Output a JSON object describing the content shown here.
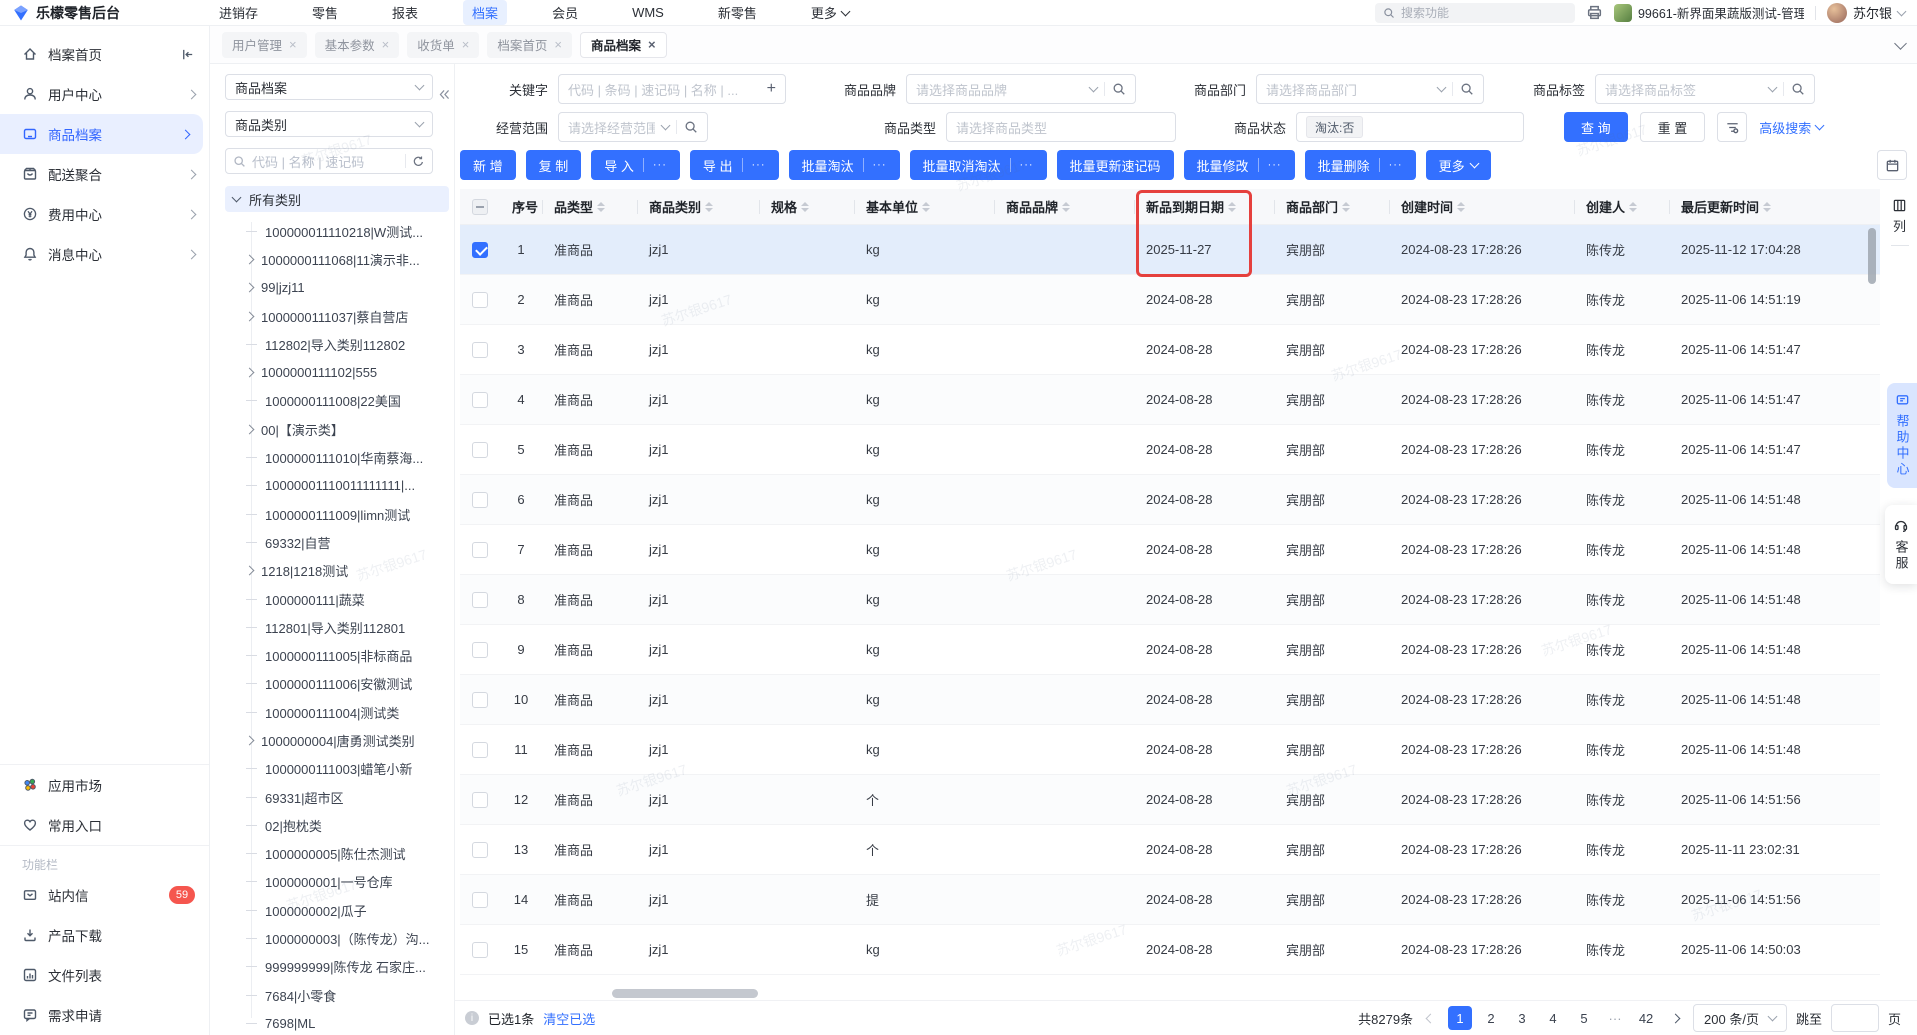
{
  "topnav": {
    "logo": "乐檬零售后台",
    "menu": [
      "进销存",
      "零售",
      "报表",
      "档案",
      "会员",
      "WMS",
      "新零售",
      "更多"
    ],
    "active_index": 3,
    "search_placeholder": "搜索功能",
    "tenant": "99661-新界面果蔬版测试-管理...",
    "user": "苏尔银"
  },
  "tabs": [
    {
      "label": "用户管理",
      "active": false
    },
    {
      "label": "基本参数",
      "active": false
    },
    {
      "label": "收货单",
      "active": false
    },
    {
      "label": "档案首页",
      "active": false
    },
    {
      "label": "商品档案",
      "active": true
    }
  ],
  "sidebar": {
    "items": [
      {
        "label": "档案首页"
      },
      {
        "label": "用户中心"
      },
      {
        "label": "商品档案"
      },
      {
        "label": "配送聚合"
      },
      {
        "label": "费用中心"
      },
      {
        "label": "消息中心"
      }
    ],
    "secondary": [
      {
        "label": "应用市场"
      },
      {
        "label": "常用入口"
      }
    ],
    "section_label": "功能栏",
    "tools": [
      {
        "label": "站内信",
        "badge": "59"
      },
      {
        "label": "产品下载"
      },
      {
        "label": "文件列表"
      },
      {
        "label": "需求申请"
      }
    ]
  },
  "tree": {
    "archive_select": "商品档案",
    "category_select": "商品类别",
    "search_placeholder": "代码 | 名称 | 速记码",
    "root": "所有类别",
    "items": [
      {
        "text": "100000011110218|W测试...",
        "expand": false
      },
      {
        "text": "1000000111068|11演示非...",
        "expand": true
      },
      {
        "text": "99|jzj11",
        "expand": true
      },
      {
        "text": "1000000111037|蔡自营店",
        "expand": true
      },
      {
        "text": "112802|导入类别112802",
        "expand": false
      },
      {
        "text": "1000000111102|555",
        "expand": true
      },
      {
        "text": "1000000111008|22美国",
        "expand": false
      },
      {
        "text": "00|【演示类】",
        "expand": true
      },
      {
        "text": "1000000111010|华南蔡海...",
        "expand": false
      },
      {
        "text": "10000001110011111111|...",
        "expand": false
      },
      {
        "text": "1000000111009|limn测试",
        "expand": false
      },
      {
        "text": "69332|自营",
        "expand": false
      },
      {
        "text": "1218|1218测试",
        "expand": true
      },
      {
        "text": "1000000111|蔬菜",
        "expand": false
      },
      {
        "text": "112801|导入类别112801",
        "expand": false
      },
      {
        "text": "1000000111005|非标商品",
        "expand": false
      },
      {
        "text": "1000000111006|安徽测试",
        "expand": false
      },
      {
        "text": "1000000111004|测试类",
        "expand": false
      },
      {
        "text": "1000000004|唐勇测试类别",
        "expand": true
      },
      {
        "text": "1000000111003|蜡笔小新",
        "expand": false
      },
      {
        "text": "69331|超市区",
        "expand": false
      },
      {
        "text": "02|抱枕类",
        "expand": false
      },
      {
        "text": "1000000005|陈仕杰测试",
        "expand": false
      },
      {
        "text": "1000000001|一号仓库",
        "expand": false
      },
      {
        "text": "1000000002|瓜子",
        "expand": false
      },
      {
        "text": "1000000003|（陈传龙）沟...",
        "expand": false
      },
      {
        "text": "999999999|陈传龙 石家庄...",
        "expand": false
      },
      {
        "text": "7684|小零食",
        "expand": false
      },
      {
        "text": "7698|ML",
        "expand": false
      }
    ]
  },
  "filters": {
    "keyword_label": "关键字",
    "keyword_placeholder": "代码 | 条码 | 速记码 | 名称 | ...",
    "brand_label": "商品品牌",
    "brand_placeholder": "请选择商品品牌",
    "dept_label": "商品部门",
    "dept_placeholder": "请选择商品部门",
    "tag_label": "商品标签",
    "tag_placeholder": "请选择商品标签",
    "scope_label": "经营范围",
    "scope_placeholder": "请选择经营范围",
    "type_label": "商品类型",
    "type_placeholder": "请选择商品类型",
    "status_label": "商品状态",
    "status_tag": "淘汰:否",
    "query_btn": "查 询",
    "reset_btn": "重 置",
    "advanced_link": "高级搜索"
  },
  "toolbar": {
    "buttons": [
      {
        "label": "新 增",
        "more": false
      },
      {
        "label": "复 制",
        "more": false
      },
      {
        "label": "导 入",
        "more": true
      },
      {
        "label": "导 出",
        "more": true
      },
      {
        "label": "批量淘汰",
        "more": true
      },
      {
        "label": "批量取消淘汰",
        "more": true
      },
      {
        "label": "批量更新速记码",
        "more": false
      },
      {
        "label": "批量修改",
        "more": true
      },
      {
        "label": "批量删除",
        "more": true
      },
      {
        "label": "更多",
        "more": false,
        "dropdown": true
      }
    ]
  },
  "table": {
    "headers": [
      {
        "label": "序号",
        "sortable": false
      },
      {
        "label": "品类型",
        "sortable": true
      },
      {
        "label": "商品类别",
        "sortable": true
      },
      {
        "label": "规格",
        "sortable": true
      },
      {
        "label": "基本单位",
        "sortable": true
      },
      {
        "label": "商品品牌",
        "sortable": true
      },
      {
        "label": "新品到期日期",
        "sortable": true,
        "annotated": true
      },
      {
        "label": "商品部门",
        "sortable": true
      },
      {
        "label": "创建时间",
        "sortable": true
      },
      {
        "label": "创建人",
        "sortable": true
      },
      {
        "label": "最后更新时间",
        "sortable": true
      }
    ],
    "rows": [
      {
        "seq": "1",
        "type": "准商品",
        "category": "jzj1",
        "spec": "",
        "unit": "kg",
        "brand": "",
        "new_date": "2025-11-27",
        "dept": "宾朋部",
        "created": "2024-08-23 17:28:26",
        "creator": "陈传龙",
        "updated": "2025-11-12 17:04:28",
        "selected": true
      },
      {
        "seq": "2",
        "type": "准商品",
        "category": "jzj1",
        "spec": "",
        "unit": "kg",
        "brand": "",
        "new_date": "2024-08-28",
        "dept": "宾朋部",
        "created": "2024-08-23 17:28:26",
        "creator": "陈传龙",
        "updated": "2025-11-06 14:51:19",
        "selected": false
      },
      {
        "seq": "3",
        "type": "准商品",
        "category": "jzj1",
        "spec": "",
        "unit": "kg",
        "brand": "",
        "new_date": "2024-08-28",
        "dept": "宾朋部",
        "created": "2024-08-23 17:28:26",
        "creator": "陈传龙",
        "updated": "2025-11-06 14:51:47",
        "selected": false
      },
      {
        "seq": "4",
        "type": "准商品",
        "category": "jzj1",
        "spec": "",
        "unit": "kg",
        "brand": "",
        "new_date": "2024-08-28",
        "dept": "宾朋部",
        "created": "2024-08-23 17:28:26",
        "creator": "陈传龙",
        "updated": "2025-11-06 14:51:47",
        "selected": false
      },
      {
        "seq": "5",
        "type": "准商品",
        "category": "jzj1",
        "spec": "",
        "unit": "kg",
        "brand": "",
        "new_date": "2024-08-28",
        "dept": "宾朋部",
        "created": "2024-08-23 17:28:26",
        "creator": "陈传龙",
        "updated": "2025-11-06 14:51:47",
        "selected": false
      },
      {
        "seq": "6",
        "type": "准商品",
        "category": "jzj1",
        "spec": "",
        "unit": "kg",
        "brand": "",
        "new_date": "2024-08-28",
        "dept": "宾朋部",
        "created": "2024-08-23 17:28:26",
        "creator": "陈传龙",
        "updated": "2025-11-06 14:51:48",
        "selected": false
      },
      {
        "seq": "7",
        "type": "准商品",
        "category": "jzj1",
        "spec": "",
        "unit": "kg",
        "brand": "",
        "new_date": "2024-08-28",
        "dept": "宾朋部",
        "created": "2024-08-23 17:28:26",
        "creator": "陈传龙",
        "updated": "2025-11-06 14:51:48",
        "selected": false
      },
      {
        "seq": "8",
        "type": "准商品",
        "category": "jzj1",
        "spec": "",
        "unit": "kg",
        "brand": "",
        "new_date": "2024-08-28",
        "dept": "宾朋部",
        "created": "2024-08-23 17:28:26",
        "creator": "陈传龙",
        "updated": "2025-11-06 14:51:48",
        "selected": false
      },
      {
        "seq": "9",
        "type": "准商品",
        "category": "jzj1",
        "spec": "",
        "unit": "kg",
        "brand": "",
        "new_date": "2024-08-28",
        "dept": "宾朋部",
        "created": "2024-08-23 17:28:26",
        "creator": "陈传龙",
        "updated": "2025-11-06 14:51:48",
        "selected": false
      },
      {
        "seq": "10",
        "type": "准商品",
        "category": "jzj1",
        "spec": "",
        "unit": "kg",
        "brand": "",
        "new_date": "2024-08-28",
        "dept": "宾朋部",
        "created": "2024-08-23 17:28:26",
        "creator": "陈传龙",
        "updated": "2025-11-06 14:51:48",
        "selected": false
      },
      {
        "seq": "11",
        "type": "准商品",
        "category": "jzj1",
        "spec": "",
        "unit": "kg",
        "brand": "",
        "new_date": "2024-08-28",
        "dept": "宾朋部",
        "created": "2024-08-23 17:28:26",
        "creator": "陈传龙",
        "updated": "2025-11-06 14:51:48",
        "selected": false
      },
      {
        "seq": "12",
        "type": "准商品",
        "category": "jzj1",
        "spec": "",
        "unit": "个",
        "brand": "",
        "new_date": "2024-08-28",
        "dept": "宾朋部",
        "created": "2024-08-23 17:28:26",
        "creator": "陈传龙",
        "updated": "2025-11-06 14:51:56",
        "selected": false
      },
      {
        "seq": "13",
        "type": "准商品",
        "category": "jzj1",
        "spec": "",
        "unit": "个",
        "brand": "",
        "new_date": "2024-08-28",
        "dept": "宾朋部",
        "created": "2024-08-23 17:28:26",
        "creator": "陈传龙",
        "updated": "2025-11-11 23:02:31",
        "selected": false
      },
      {
        "seq": "14",
        "type": "准商品",
        "category": "jzj1",
        "spec": "",
        "unit": "提",
        "brand": "",
        "new_date": "2024-08-28",
        "dept": "宾朋部",
        "created": "2024-08-23 17:28:26",
        "creator": "陈传龙",
        "updated": "2025-11-06 14:51:56",
        "selected": false
      },
      {
        "seq": "15",
        "type": "准商品",
        "category": "jzj1",
        "spec": "",
        "unit": "kg",
        "brand": "",
        "new_date": "2024-08-28",
        "dept": "宾朋部",
        "created": "2024-08-23 17:28:26",
        "creator": "陈传龙",
        "updated": "2025-11-06 14:50:03",
        "selected": false
      }
    ]
  },
  "column_tool": "列",
  "floaters": {
    "help": "帮助中心",
    "service": "客服"
  },
  "footer": {
    "selected_text": "已选1条",
    "clear_link": "清空已选",
    "total": "共8279条",
    "pages": [
      "1",
      "2",
      "3",
      "4",
      "5",
      "···",
      "42"
    ],
    "active_page": "1",
    "page_size": "200 条/页",
    "jump_label": "跳至",
    "jump_suffix": "页"
  },
  "watermark": "苏尔银9617",
  "colors": {
    "accent": "#3370ff",
    "annotation": "#e5403d",
    "selected_row": "#e3edfb",
    "badge": "#f5564e"
  }
}
